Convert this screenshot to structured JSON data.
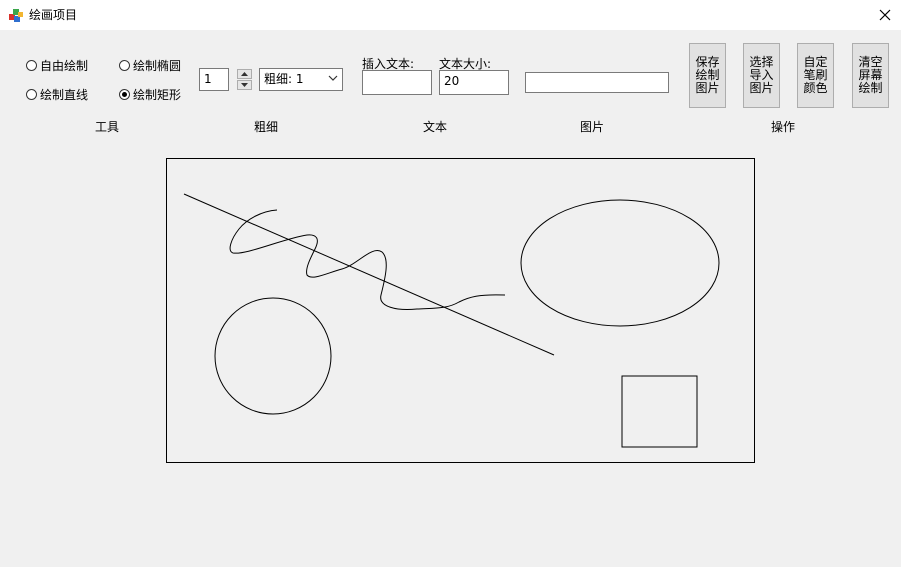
{
  "window": {
    "title": "绘画项目",
    "close_glyph": "✕"
  },
  "tools": {
    "group_label": "工具",
    "options": [
      {
        "label": "自由绘制",
        "selected": false
      },
      {
        "label": "绘制椭圆",
        "selected": false
      },
      {
        "label": "绘制直线",
        "selected": false
      },
      {
        "label": "绘制矩形",
        "selected": true
      }
    ]
  },
  "thickness": {
    "group_label": "粗细",
    "spinner_value": "1",
    "combo_value": "粗细: 1"
  },
  "text": {
    "group_label": "文本",
    "insert_label": "插入文本:",
    "insert_value": "",
    "size_label": "文本大小:",
    "size_value": "20"
  },
  "image": {
    "group_label": "图片",
    "path_value": ""
  },
  "actions": {
    "group_label": "操作",
    "buttons": [
      "保存绘制图片",
      "选择导入图片",
      "自定笔刷颜色",
      "清空屏幕绘制"
    ]
  },
  "colors": {
    "window_bg": "#f0f0f0",
    "titlebar_bg": "#ffffff",
    "stroke": "#000000"
  }
}
